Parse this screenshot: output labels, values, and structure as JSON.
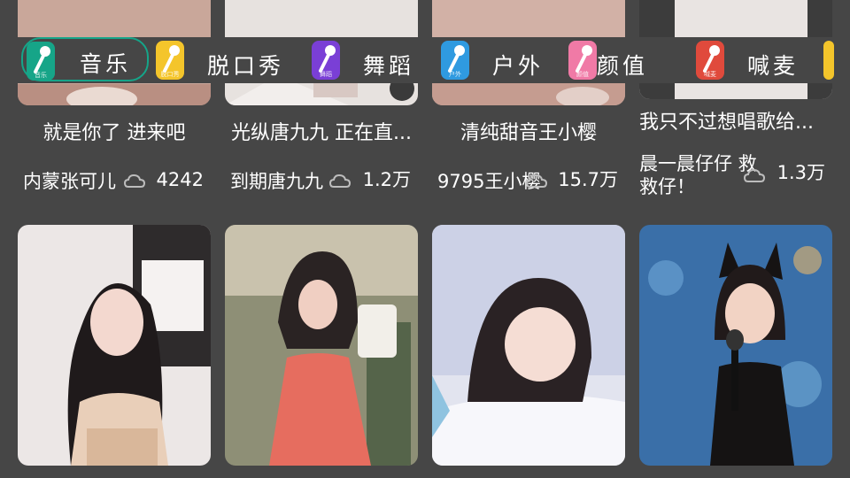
{
  "tabs": [
    {
      "label": "音乐",
      "icon_caption": "音乐",
      "icon": "microphone-icon",
      "color": "#16a588",
      "selected": true
    },
    {
      "label": "脱口秀",
      "icon_caption": "脱口秀",
      "icon": "microphone-icon",
      "color": "#f4c52b",
      "selected": false
    },
    {
      "label": "舞蹈",
      "icon_caption": "舞蹈",
      "icon": "microphone-icon",
      "color": "#7a3fd6",
      "selected": false
    },
    {
      "label": "户外",
      "icon_caption": "户外",
      "icon": "microphone-icon",
      "color": "#2f9ae0",
      "selected": false
    },
    {
      "label": "颜值",
      "icon_caption": "颜值",
      "icon": "microphone-icon",
      "color": "#f07aa6",
      "selected": false
    },
    {
      "label": "喊麦",
      "icon_caption": "喊麦",
      "icon": "microphone-icon",
      "color": "#e04a3c",
      "selected": false
    }
  ],
  "top_row": [
    {
      "title": "就是你了 进来吧",
      "streamer": "内蒙张可儿",
      "viewers": "4242"
    },
    {
      "title": "光纵唐九九 正在直...",
      "streamer": "到期唐九九",
      "viewers": "1.2万"
    },
    {
      "title": "清纯甜音王小樱",
      "streamer": "9795王小樱",
      "viewers": "15.7万"
    },
    {
      "title": "我只不过想唱歌给...",
      "streamer": "晨一晨仔仔 救救仔！",
      "viewers": "1.3万"
    }
  ],
  "bottom_row": [
    {
      "thumb": "streamer-photo"
    },
    {
      "thumb": "streamer-photo"
    },
    {
      "thumb": "streamer-photo"
    },
    {
      "thumb": "streamer-photo"
    }
  ],
  "colors": {
    "background": "#464646",
    "selected_tab_border": "#15a589",
    "text": "#ffffff"
  }
}
